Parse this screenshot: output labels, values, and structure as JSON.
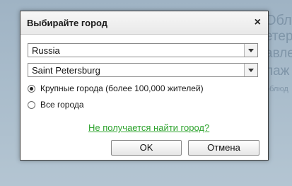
{
  "background": {
    "lines": [
      "Обла",
      "етер",
      "авле",
      "лаж",
      "облюд"
    ]
  },
  "dialog": {
    "title": "Выбирайте город",
    "close_glyph": "×",
    "country_select": {
      "value": "Russia"
    },
    "city_select": {
      "value": "Saint Petersburg"
    },
    "options": [
      {
        "label": "Крупные города (более 100,000 жителей)",
        "selected": true
      },
      {
        "label": "Все города",
        "selected": false
      }
    ],
    "help_link": "Не получается найти город?",
    "ok_label": "OK",
    "cancel_label": "Отмена"
  },
  "colors": {
    "link": "#2ea32e",
    "border": "#3b3b3b"
  }
}
